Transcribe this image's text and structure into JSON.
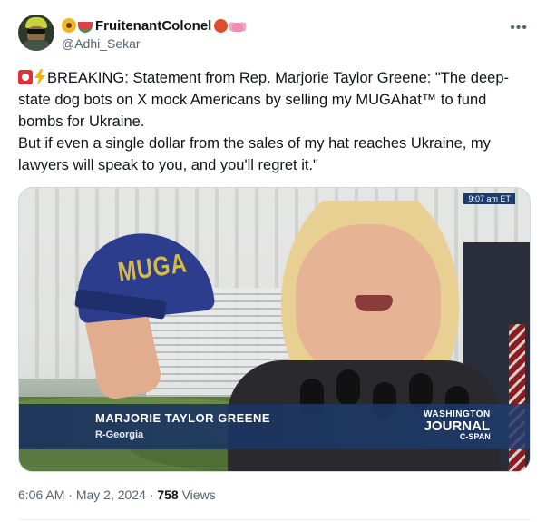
{
  "user": {
    "display_name": "FruitenantColonel",
    "handle": "@Adhi_Sekar",
    "more_icon": "ellipsis-icon"
  },
  "tweet": {
    "line1": "BREAKING: Statement from Rep. Marjorie Taylor Greene: \"The deep-state dog bots on X mock Americans by selling my MUGAhat™ to fund bombs for Ukraine.",
    "line2": "But if even a single dollar from the sales of my hat reaches Ukraine, my lawyers will speak to you, and you'll regret it.\""
  },
  "media": {
    "cap_text": "MUGA",
    "timestamp": "9:07 am ET",
    "lower_third_name": "MARJORIE TAYLOR GREENE",
    "lower_third_sub": "R-Georgia",
    "brand_line1": "WASHINGTON",
    "brand_line2": "JOURNAL",
    "brand_line3": "C-SPAN"
  },
  "meta": {
    "time": "6:06 AM",
    "sep1": "·",
    "date": "May 2, 2024",
    "sep2": "·",
    "views_count": "758",
    "views_label": "Views"
  },
  "colors": {
    "text": "#0f1419",
    "muted": "#536471",
    "border": "#cfd9de"
  }
}
